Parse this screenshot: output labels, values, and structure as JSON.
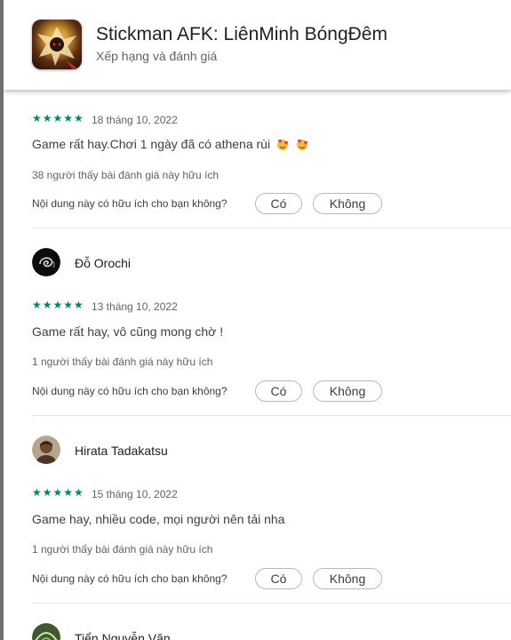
{
  "app": {
    "title": "Stickman AFK: LiênMinh BóngĐêm",
    "subtitle": "Xếp hạng và đánh giá"
  },
  "question": "Nội dung này có hữu ích cho bạn không?",
  "buttons": {
    "yes": "Có",
    "no": "Không"
  },
  "reviews": [
    {
      "author": "",
      "stars": "★★★★★",
      "rating": 5,
      "date": "18 tháng 10, 2022",
      "text": "Game rất hay.Chơi 1 ngày đã có athena rùi",
      "emoji": "face-with-hearts-icon",
      "helpful": "38 người thấy bài đánh giá này hữu ích"
    },
    {
      "author": "Đỗ Orochi",
      "stars": "★★★★★",
      "rating": 5,
      "date": "13 tháng 10, 2022",
      "text": "Game rất hay, vô cũng mong chờ !",
      "helpful": "1 người thấy bài đánh giá này hữu ích"
    },
    {
      "author": "Hirata Tadakatsu",
      "stars": "★★★★★",
      "rating": 5,
      "date": "15 tháng 10, 2022",
      "text": "Game hay, nhiều code, mọi người nên tải nha",
      "helpful": "1 người thấy bài đánh giá này hữu ích"
    },
    {
      "author": "Tiển Nguyễn Văn"
    }
  ],
  "colors": {
    "star": "#01875f",
    "text": "#3c4043",
    "secondary": "#5f6368"
  }
}
